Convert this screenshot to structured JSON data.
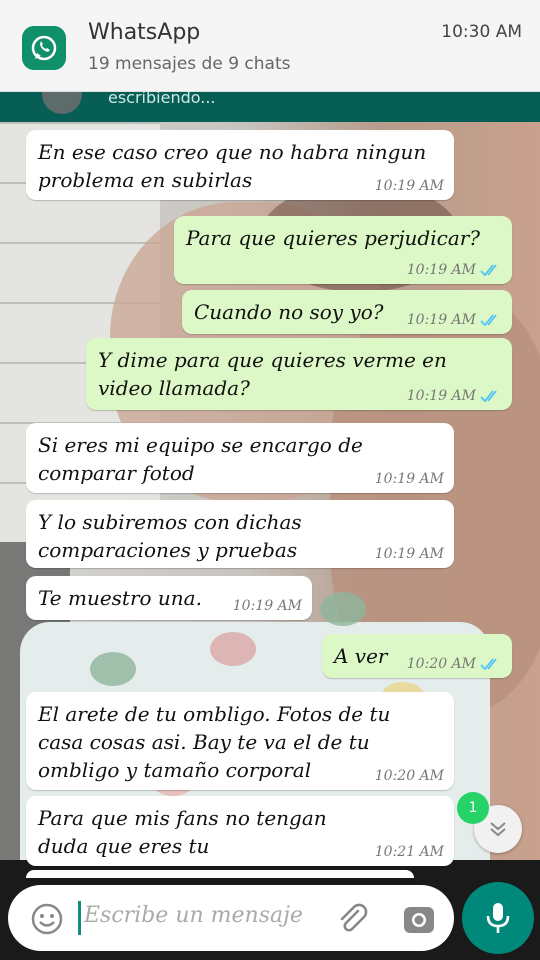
{
  "notification": {
    "app": "WhatsApp",
    "summary": "19 mensajes de 9 chats",
    "time": "10:30 AM"
  },
  "header": {
    "status": "escribiendo..."
  },
  "messages": [
    {
      "dir": "in",
      "text": "En ese caso creo que no habra ningun problema en subirlas",
      "time": "10:19 AM"
    },
    {
      "dir": "out",
      "text": "Para que quieres perjudicar?",
      "time": "10:19 AM",
      "read": true
    },
    {
      "dir": "out",
      "text": "Cuando no soy yo?",
      "time": "10:19 AM",
      "read": true
    },
    {
      "dir": "out",
      "text": "Y dime para que quieres verme en video llamada?",
      "time": "10:19 AM",
      "read": true
    },
    {
      "dir": "in",
      "text": "Si eres mi equipo se encargo de comparar fotod",
      "time": "10:19 AM"
    },
    {
      "dir": "in",
      "text": "Y lo subiremos con dichas comparaciones y pruebas",
      "time": "10:19 AM"
    },
    {
      "dir": "in",
      "text": "Te muestro una.",
      "time": "10:19 AM"
    },
    {
      "dir": "out",
      "text": "A ver",
      "time": "10:20 AM",
      "read": true
    },
    {
      "dir": "in",
      "text": "El arete de tu ombligo. Fotos de tu casa cosas asi. Bay te va el de tu ombligo y tamaño corporal",
      "time": "10:20 AM"
    },
    {
      "dir": "in",
      "text": "Para que mis fans no tengan duda que eres tu",
      "time": "10:21 AM"
    }
  ],
  "unread_count": "1",
  "composer": {
    "placeholder": "Escribe un mensaje"
  },
  "colors": {
    "accent": "#00897b",
    "outgoing": "#dcf8c6",
    "incoming": "#ffffff",
    "read_ticks": "#4fc3f7"
  },
  "icons": [
    "whatsapp-icon",
    "emoji-icon",
    "attach-icon",
    "camera-icon",
    "mic-icon",
    "double-check-icon",
    "chevron-down-icon"
  ]
}
